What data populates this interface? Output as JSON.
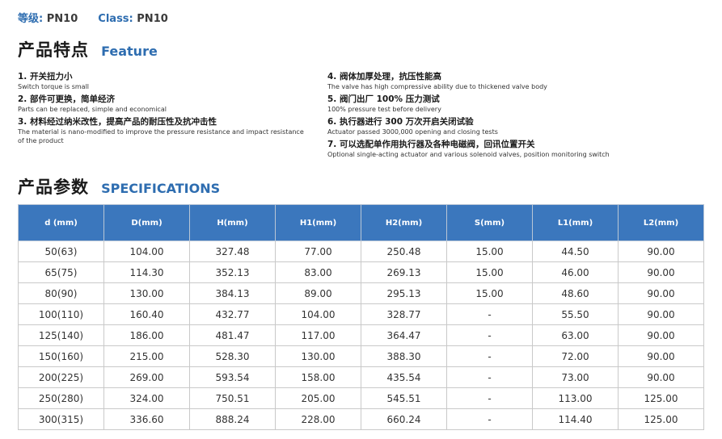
{
  "class_line": {
    "grade_label": "等级:",
    "grade_value": "PN10",
    "class_label": "Class:",
    "class_value": "PN10"
  },
  "feature_section": {
    "title_zh": "产品特点",
    "title_en": "Feature",
    "left_items": [
      {
        "zh": "1. 开关扭力小",
        "en": "Switch torque is small"
      },
      {
        "zh": "2. 部件可更换，简单经济",
        "en": "Parts can be replaced, simple and economical"
      },
      {
        "zh": "3. 材料经过纳米改性，提高产品的耐压性及抗冲击性",
        "en": "The material is nano-modified to improve the pressure resistance and impact resistance of the product"
      }
    ],
    "right_items": [
      {
        "zh": "4. 阀体加厚处理，抗压性能高",
        "en": "The valve has high compressive ability due to thickened valve body"
      },
      {
        "zh": "5. 阀门出厂 100% 压力测试",
        "en": "100% pressure test before delivery"
      },
      {
        "zh": "6. 执行器进行 300 万次开启关闭试验",
        "en": "Actuator passed 3000,000 opening and closing tests"
      },
      {
        "zh": "7. 可以选配单作用执行器及各种电磁阀，回讯位置开关",
        "en": "Optional single-acting actuator and various solenoid valves, position monitoring switch"
      }
    ]
  },
  "spec_section": {
    "title_zh": "产品参数",
    "title_en": "SPECIFICATIONS",
    "headers": [
      "d (mm)",
      "D(mm)",
      "H(mm)",
      "H1(mm)",
      "H2(mm)",
      "S(mm)",
      "L1(mm)",
      "L2(mm)"
    ],
    "rows": [
      [
        "50(63)",
        "104.00",
        "327.48",
        "77.00",
        "250.48",
        "15.00",
        "44.50",
        "90.00"
      ],
      [
        "65(75)",
        "114.30",
        "352.13",
        "83.00",
        "269.13",
        "15.00",
        "46.00",
        "90.00"
      ],
      [
        "80(90)",
        "130.00",
        "384.13",
        "89.00",
        "295.13",
        "15.00",
        "48.60",
        "90.00"
      ],
      [
        "100(110)",
        "160.40",
        "432.77",
        "104.00",
        "328.77",
        "-",
        "55.50",
        "90.00"
      ],
      [
        "125(140)",
        "186.00",
        "481.47",
        "117.00",
        "364.47",
        "-",
        "63.00",
        "90.00"
      ],
      [
        "150(160)",
        "215.00",
        "528.30",
        "130.00",
        "388.30",
        "-",
        "72.00",
        "90.00"
      ],
      [
        "200(225)",
        "269.00",
        "593.54",
        "158.00",
        "435.54",
        "-",
        "73.00",
        "90.00"
      ],
      [
        "250(280)",
        "324.00",
        "750.51",
        "205.00",
        "545.51",
        "-",
        "113.00",
        "125.00"
      ],
      [
        "300(315)",
        "336.60",
        "888.24",
        "228.00",
        "660.24",
        "-",
        "114.40",
        "125.00"
      ]
    ]
  },
  "colors": {
    "accent_blue": "#2e6db0",
    "header_blue": "#3b77bd"
  }
}
